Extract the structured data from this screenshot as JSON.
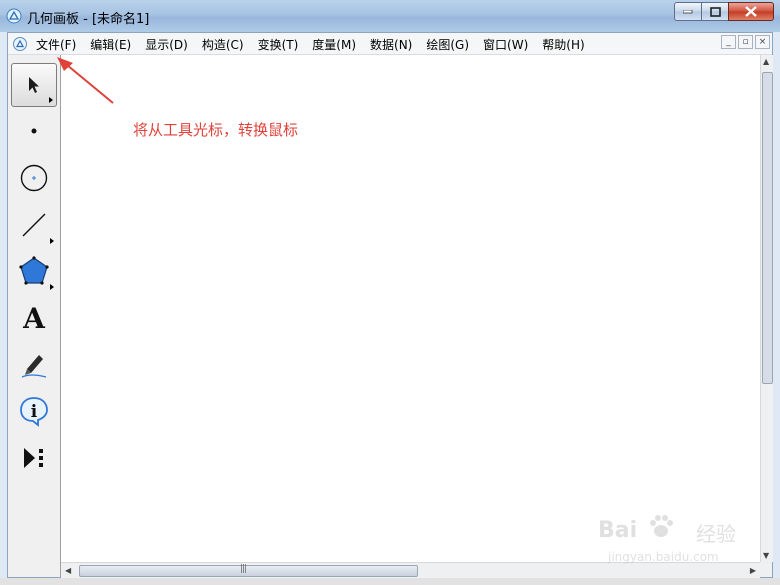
{
  "window": {
    "title": "几何画板 - [未命名1]",
    "controls": {
      "minimize": "minimize",
      "maximize": "maximize",
      "close": "close"
    }
  },
  "menubar": {
    "items": [
      "文件(F)",
      "编辑(E)",
      "显示(D)",
      "构造(C)",
      "变换(T)",
      "度量(M)",
      "数据(N)",
      "绘图(G)",
      "窗口(W)",
      "帮助(H)"
    ],
    "mdi_controls": [
      "_",
      "▫",
      "×"
    ]
  },
  "toolbox": {
    "tools": [
      {
        "name": "selection-arrow-tool",
        "icon": "arrow-cursor-icon",
        "active": true
      },
      {
        "name": "point-tool",
        "icon": "point-icon",
        "active": false
      },
      {
        "name": "compass-tool",
        "icon": "circle-icon",
        "active": false
      },
      {
        "name": "straightedge-tool",
        "icon": "segment-icon",
        "active": false
      },
      {
        "name": "polygon-tool",
        "icon": "pentagon-icon",
        "active": false
      },
      {
        "name": "text-tool",
        "icon": "text-A-icon",
        "label": "A",
        "active": false
      },
      {
        "name": "marker-tool",
        "icon": "pen-icon",
        "active": false
      },
      {
        "name": "information-tool",
        "icon": "info-icon",
        "label": "i",
        "active": false
      },
      {
        "name": "custom-tools",
        "icon": "play-more-icon",
        "active": false
      }
    ]
  },
  "canvas": {
    "annotation": "将从工具光标，转换鼠标",
    "annotation_color": "#e0423a"
  },
  "watermark": {
    "brand": "Bai",
    "brand_cn": "经验",
    "url": "jingyan.baidu.com"
  },
  "colors": {
    "polygon_fill": "#2f78d8",
    "accent_red": "#e0423a"
  }
}
